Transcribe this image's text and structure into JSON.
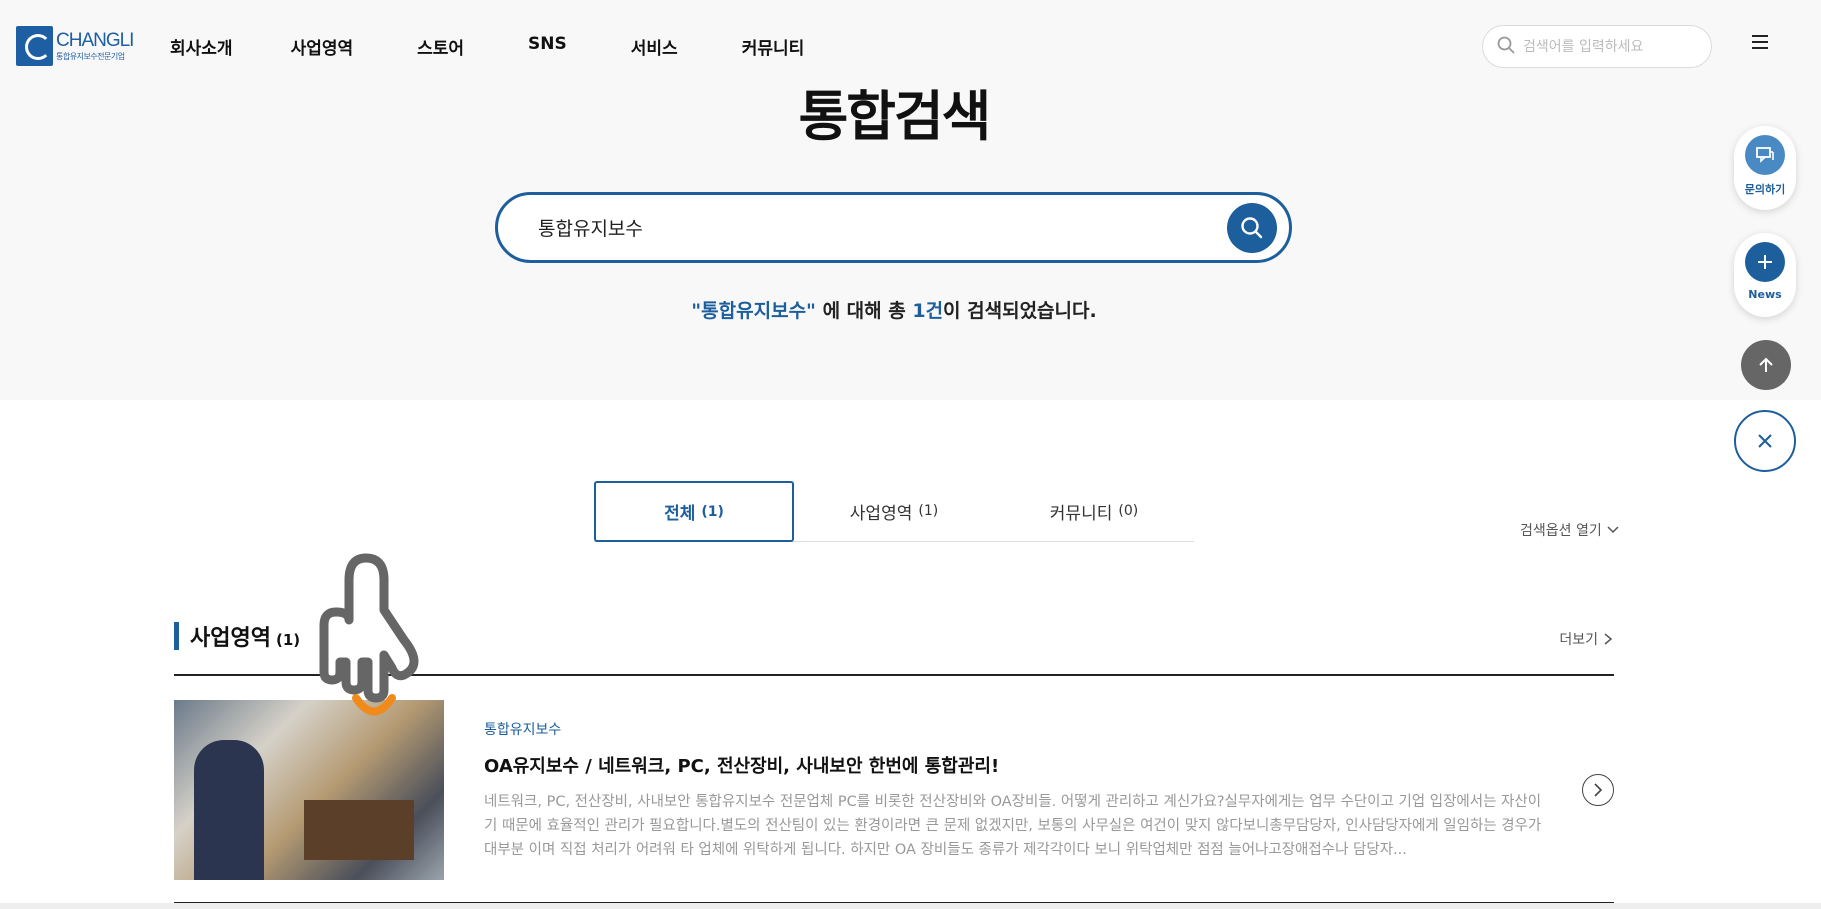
{
  "header": {
    "logo_name": "CHANGLI",
    "logo_sub": "통합유지보수전문기업",
    "nav": [
      "회사소개",
      "사업영역",
      "스토어",
      "SNS",
      "서비스",
      "커뮤니티"
    ],
    "search_placeholder": "검색어를 입력하세요"
  },
  "hero": {
    "title": "통합검색",
    "search_value": "통합유지보수",
    "summary": {
      "keyword": "\"통합유지보수\"",
      "text_before_count": " 에 대해 총 ",
      "count": "1건",
      "text_after_count": "이 검색되었습니다."
    }
  },
  "tabs": [
    {
      "label": "전체",
      "count": "(1)",
      "active": true
    },
    {
      "label": "사업영역",
      "count": "(1)",
      "active": false
    },
    {
      "label": "커뮤니티",
      "count": "(0)",
      "active": false
    }
  ],
  "search_options_label": "검색옵션 열기",
  "section": {
    "title": "사업영역",
    "count": "(1)",
    "more_label": "더보기"
  },
  "result": {
    "category": "통합유지보수",
    "title": "OA유지보수 / 네트워크, PC, 전산장비, 사내보안 한번에 통합관리!",
    "description": "네트워크, PC, 전산장비, 사내보안 통합유지보수 전문업체  PC를 비롯한 전산장비와 OA장비들. 어떻게 관리하고 계신가요?실무자에게는 업무 수단이고 기업 입장에서는 자산이기 때문에 효율적인 관리가 필요합니다.별도의 전산팀이 있는 환경이라면 큰 문제 없겠지만, 보통의 사무실은 여건이 맞지 않다보니총무담당자, 인사담당자에게 일임하는 경우가 대부분 이며 직접 처리가 어려워 타 업체에 위탁하게 됩니다.   하지만 OA 장비들도 종류가 제각각이다 보니 위탁업체만 점점 늘어나고장애접수나 담당자..."
  },
  "quick": {
    "inquiry_label": "문의하기",
    "news_label": "News"
  },
  "colors": {
    "accent": "#1d5e9c",
    "hero_bg": "#f8f8f8",
    "top_button": "#666666"
  },
  "icons": [
    "search-icon",
    "menu-icon",
    "chevron-down-icon",
    "chevron-right-icon",
    "chat-icon",
    "plus-icon",
    "arrow-up-icon",
    "close-icon",
    "hand-pointer-icon"
  ]
}
